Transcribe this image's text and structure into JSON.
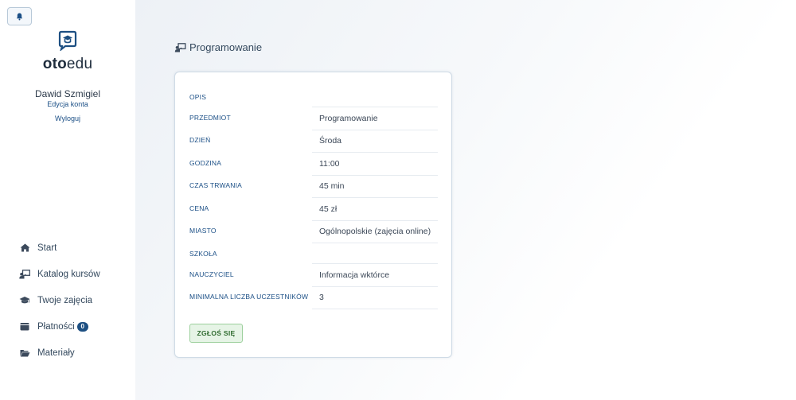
{
  "app": {
    "logo_bold": "oto",
    "logo_light": "edu"
  },
  "user": {
    "name": "Dawid Szmigiel",
    "edit_label": "Edycja konta",
    "logout_label": "Wyloguj"
  },
  "nav": {
    "items": [
      {
        "label": "Start",
        "icon": "home-icon"
      },
      {
        "label": "Katalog kursów",
        "icon": "teacher-board-icon"
      },
      {
        "label": "Twoje zajęcia",
        "icon": "graduation-cap-icon"
      },
      {
        "label": "Płatności",
        "icon": "wallet-icon",
        "badge": "0"
      },
      {
        "label": "Materiały",
        "icon": "folder-open-icon"
      }
    ]
  },
  "page": {
    "title": "Programowanie",
    "title_icon": "teacher-board-icon"
  },
  "details": {
    "rows": [
      {
        "label": "OPIS",
        "value": ""
      },
      {
        "label": "PRZEDMIOT",
        "value": "Programowanie"
      },
      {
        "label": "DZIEŃ",
        "value": "Środa"
      },
      {
        "label": "GODZINA",
        "value": "11:00"
      },
      {
        "label": "CZAS TRWANIA",
        "value": "45 min"
      },
      {
        "label": "CENA",
        "value": "45 zł"
      },
      {
        "label": "MIASTO",
        "value": "Ogólnopolskie (zajęcia online)"
      },
      {
        "label": "SZKOŁA",
        "value": ""
      },
      {
        "label": "NAUCZYCIEL",
        "value": "Informacja wktórce"
      },
      {
        "label": "MINIMALNA LICZBA UCZESTNIKÓW",
        "value": "3"
      }
    ],
    "apply_label": "ZGŁOŚ SIĘ"
  },
  "colors": {
    "accent": "#1b4f86",
    "badge": "#1d4f82",
    "apply_bg": "#e6f4e6",
    "apply_text": "#2f6b2f"
  }
}
